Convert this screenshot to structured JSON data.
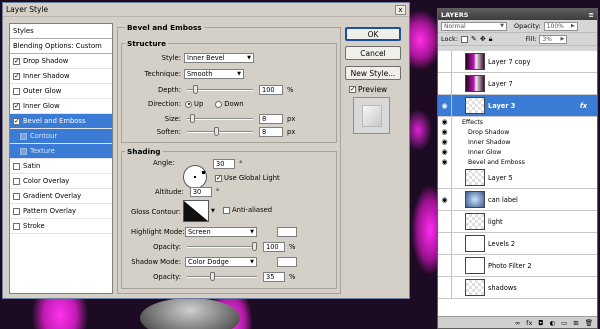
{
  "dialog": {
    "title": "Layer Style",
    "close": "x",
    "styles_list": {
      "header": "Styles",
      "blending": "Blending Options: Custom",
      "items": [
        {
          "label": "Drop Shadow",
          "checked": true
        },
        {
          "label": "Inner Shadow",
          "checked": true
        },
        {
          "label": "Outer Glow",
          "checked": false
        },
        {
          "label": "Inner Glow",
          "checked": true
        },
        {
          "label": "Bevel and Emboss",
          "checked": true,
          "selected": true
        },
        {
          "label": "Contour",
          "checked": false,
          "sub": true
        },
        {
          "label": "Texture",
          "checked": false,
          "sub": true
        },
        {
          "label": "Satin",
          "checked": false
        },
        {
          "label": "Color Overlay",
          "checked": false
        },
        {
          "label": "Gradient Overlay",
          "checked": false
        },
        {
          "label": "Pattern Overlay",
          "checked": false
        },
        {
          "label": "Stroke",
          "checked": false
        }
      ]
    },
    "panel_title": "Bevel and Emboss",
    "structure": {
      "title": "Structure",
      "style_label": "Style:",
      "style_value": "Inner Bevel",
      "technique_label": "Technique:",
      "technique_value": "Smooth",
      "depth_label": "Depth:",
      "depth_value": "100",
      "depth_unit": "%",
      "depth_level": 0.1,
      "direction_label": "Direction:",
      "dir_up": "Up",
      "dir_down": "Down",
      "size_label": "Size:",
      "size_value": "8",
      "size_unit": "px",
      "size_level": 0.05,
      "soften_label": "Soften:",
      "soften_value": "8",
      "soften_unit": "px",
      "soften_level": 0.45
    },
    "shading": {
      "title": "Shading",
      "angle_label": "Angle:",
      "angle_value": "30",
      "angle_unit": "°",
      "global_light_label": "Use Global Light",
      "altitude_label": "Altitude:",
      "altitude_value": "30",
      "altitude_unit": "°",
      "gloss_label": "Gloss Contour:",
      "anti_aliased_label": "Anti-aliased",
      "highlight_label": "Highlight Mode:",
      "highlight_value": "Screen",
      "highlight_opacity_label": "Opacity:",
      "highlight_opacity_value": "100",
      "highlight_opacity_unit": "%",
      "highlight_opacity_level": 1.0,
      "shadow_label": "Shadow Mode:",
      "shadow_value": "Color Dodge",
      "shadow_opacity_label": "Opacity:",
      "shadow_opacity_value": "35",
      "shadow_opacity_unit": "%",
      "shadow_opacity_level": 0.35
    },
    "buttons": {
      "ok": "OK",
      "cancel": "Cancel",
      "new_style": "New Style...",
      "preview": "Preview"
    }
  },
  "layers_panel": {
    "title": "LAYERS",
    "close": "x",
    "menu": "≡",
    "blend_mode": "Normal",
    "opacity_label": "Opacity:",
    "opacity_value": "100%",
    "lock_label": "Lock:",
    "fill_label": "Fill:",
    "fill_value": "3%",
    "layers": [
      {
        "name": "Layer 7 copy",
        "thumb": "pink",
        "visible": false
      },
      {
        "name": "Layer 7",
        "thumb": "pink",
        "visible": false
      },
      {
        "name": "Layer 3",
        "thumb": "check",
        "visible": true,
        "selected": true,
        "fx": "fx"
      },
      {
        "name": "Layer 5",
        "thumb": "check",
        "visible": false
      },
      {
        "name": "can label",
        "thumb": "blue",
        "visible": true
      },
      {
        "name": "light",
        "thumb": "check",
        "visible": false
      },
      {
        "name": "Levels 2",
        "thumb": "level",
        "visible": false
      },
      {
        "name": "Photo Filter 2",
        "thumb": "white",
        "visible": false
      },
      {
        "name": "shadows",
        "thumb": "check",
        "visible": false
      }
    ],
    "effects_label": "Effects",
    "effects": [
      "Drop Shadow",
      "Inner Shadow",
      "Inner Glow",
      "Bevel and Emboss"
    ]
  }
}
